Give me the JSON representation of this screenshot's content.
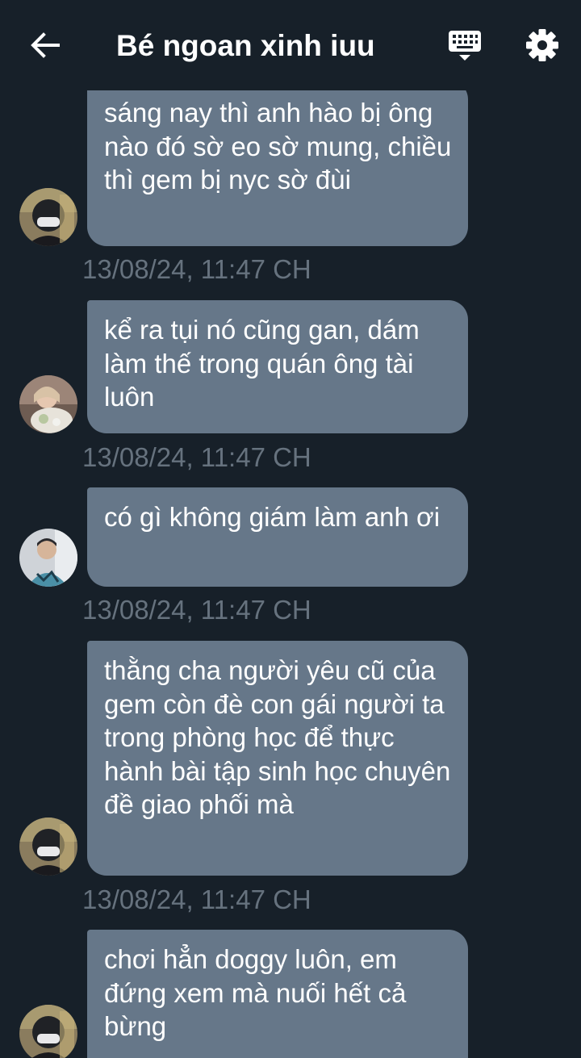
{
  "header": {
    "title": "Bé ngoan xinh iuu",
    "back_icon": "arrow-left-icon",
    "keyboard_icon": "keyboard-icon",
    "settings_icon": "gear-icon"
  },
  "colors": {
    "background": "#172029",
    "bubble": "#667789",
    "timestamp": "#66727e",
    "text": "#ffffff"
  },
  "messages": [
    {
      "text": "sáng nay thì anh hào bị ông nào đó sờ eo sờ mung, chiều thì gem bị nyc sờ đùi",
      "timestamp": "13/08/24, 11:47 CH"
    },
    {
      "text": "kể ra tụi nó cũng gan, dám làm thế trong quán ông tài luôn",
      "timestamp": "13/08/24, 11:47 CH"
    },
    {
      "text": "có gì không giám làm anh ơi",
      "timestamp": "13/08/24, 11:47 CH"
    },
    {
      "text": "thằng cha người yêu cũ của gem còn đè con gái người ta trong phòng học để thực hành bài tập sinh học chuyên đề giao phối mà",
      "timestamp": "13/08/24, 11:47 CH"
    },
    {
      "text": "chơi hẳn doggy luôn, em đứng xem mà nuối hết cả bừng",
      "timestamp": ""
    }
  ]
}
